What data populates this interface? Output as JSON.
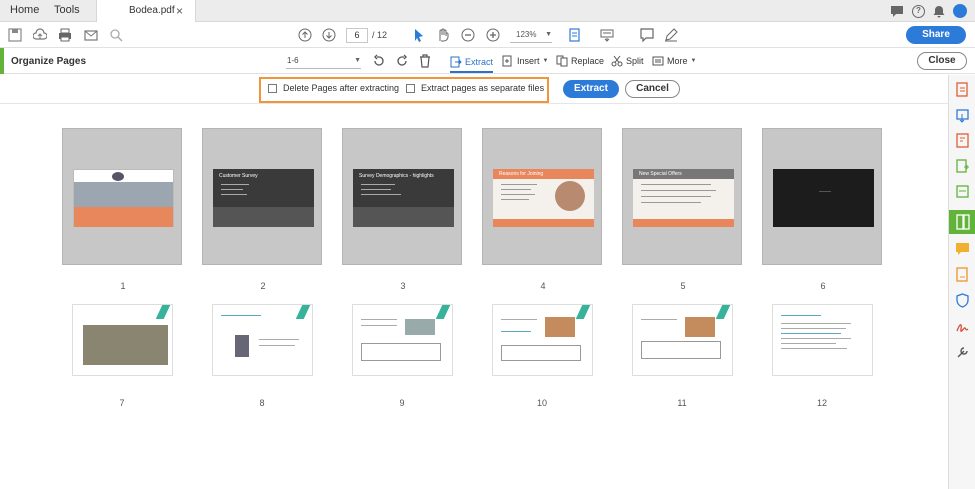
{
  "tabs": {
    "home": "Home",
    "tools": "Tools",
    "document": "Bodea.pdf",
    "close_symbol": "×"
  },
  "toolbar": {
    "current_page": "6",
    "total_pages": "/ 12",
    "zoom": "123%",
    "share_label": "Share"
  },
  "organize": {
    "title": "Organize Pages",
    "page_range": "1-6",
    "extract_label": "Extract",
    "insert_label": "Insert",
    "replace_label": "Replace",
    "split_label": "Split",
    "more_label": "More",
    "close_label": "Close"
  },
  "extract_options": {
    "delete_after_label": "Delete Pages after extracting",
    "separate_files_label": "Extract pages as separate files",
    "extract_button": "Extract",
    "cancel_button": "Cancel"
  },
  "pages": [
    {
      "num": "1",
      "selected": true,
      "title": ""
    },
    {
      "num": "2",
      "selected": true,
      "title": "Customer Survey"
    },
    {
      "num": "3",
      "selected": true,
      "title": "Survey Demographics - highlights"
    },
    {
      "num": "4",
      "selected": true,
      "title": "Reasons for Joining"
    },
    {
      "num": "5",
      "selected": true,
      "title": "New Special Offers"
    },
    {
      "num": "6",
      "selected": true,
      "title": ""
    },
    {
      "num": "7",
      "selected": false,
      "title": ""
    },
    {
      "num": "8",
      "selected": false,
      "title": ""
    },
    {
      "num": "9",
      "selected": false,
      "title": ""
    },
    {
      "num": "10",
      "selected": false,
      "title": ""
    },
    {
      "num": "11",
      "selected": false,
      "title": ""
    },
    {
      "num": "12",
      "selected": false,
      "title": ""
    }
  ],
  "colors": {
    "accent_blue": "#2d7bd8",
    "organize_green": "#61b33a",
    "highlight_orange": "#f1953b",
    "selected_page_bg": "#c7c7c7"
  }
}
